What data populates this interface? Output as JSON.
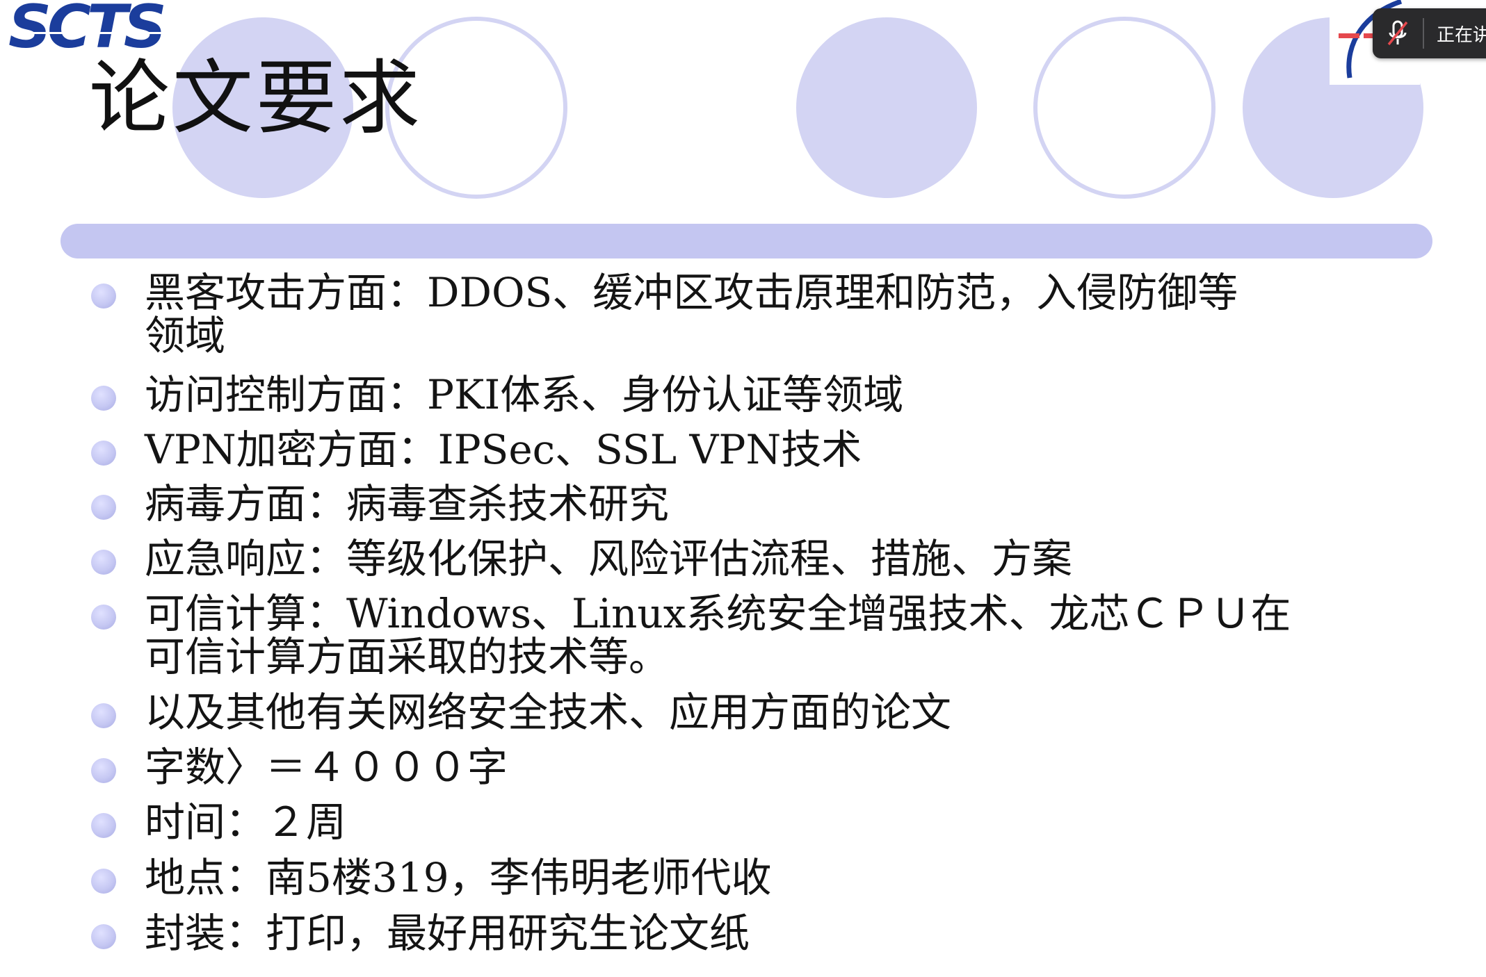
{
  "slide": {
    "logo_text": "SCTS",
    "title": "论文要求",
    "bullets": [
      {
        "line1": "黑客攻击方面：DDOS、缓冲区攻击原理和防范，入侵防御等",
        "line2": "领域"
      },
      {
        "line1": "访问控制方面：PKI体系、身份认证等领域"
      },
      {
        "line1": "VPN加密方面：IPSec、SSL VPN技术"
      },
      {
        "line1": "病毒方面：病毒查杀技术研究"
      },
      {
        "line1": "应急响应：等级化保护、风险评估流程、措施、方案"
      },
      {
        "line1": "可信计算：Windows、Linux系统安全增强技术、龙芯ＣＰＵ在",
        "line2": "可信计算方面采取的技术等。"
      },
      {
        "line1": "以及其他有关网络安全技术、应用方面的论文"
      },
      {
        "line1": "字数〉＝４０００字"
      },
      {
        "line1": "时间：２周"
      },
      {
        "line1": "地点：南5楼319，李伟明老师代收"
      },
      {
        "line1": "封装：打印，最好用研究生论文纸"
      }
    ]
  },
  "overlay": {
    "speaking_label": "正在讲",
    "mic_icon": "mic-muted-icon"
  },
  "colors": {
    "logo_blue": "#1b3d9c",
    "decor_lavender": "#d3d4f3",
    "rule": "#c4c6f1",
    "bullet": "#c6c8f3",
    "overlay_bg": "#2a2a2c",
    "mute_red": "#e5484d"
  }
}
